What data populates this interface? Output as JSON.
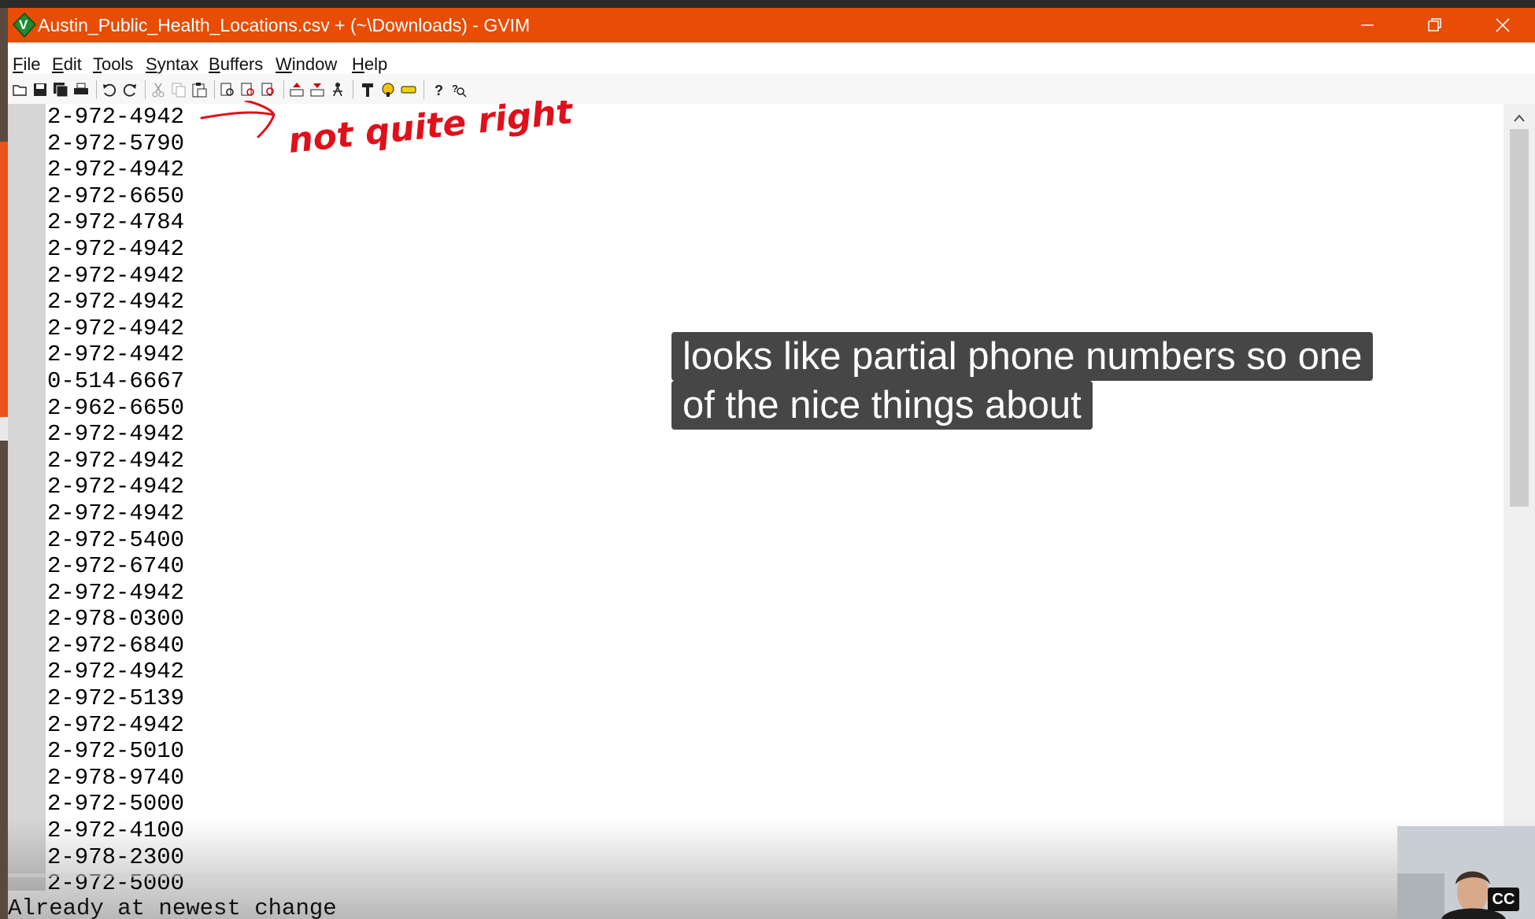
{
  "window": {
    "title": "Austin_Public_Health_Locations.csv + (~\\Downloads) - GVIM",
    "accent_color": "#e84c05"
  },
  "menu": {
    "items": [
      {
        "u": "F",
        "rest": "ile"
      },
      {
        "u": "E",
        "rest": "dit"
      },
      {
        "u": "T",
        "rest": "ools"
      },
      {
        "u": "S",
        "rest": "yntax"
      },
      {
        "u": "B",
        "rest": "uffers"
      },
      {
        "u": "W",
        "rest": "indow"
      },
      {
        "u": "H",
        "rest": "elp"
      }
    ]
  },
  "toolbar": {
    "icons": [
      "open-icon",
      "save-icon",
      "save-all-icon",
      "print-icon",
      "undo-icon",
      "redo-icon",
      "cut-icon",
      "copy-icon",
      "paste-icon",
      "replace-icon",
      "find-next-icon",
      "find-prev-icon",
      "load-session-icon",
      "save-session-icon",
      "run-script-icon",
      "make-icon",
      "run-ctags-icon",
      "tag-jump-icon",
      "help-icon",
      "find-help-icon"
    ]
  },
  "editor": {
    "lines": [
      "2-972-4942",
      "2-972-5790",
      "2-972-4942",
      "2-972-6650",
      "2-972-4784",
      "2-972-4942",
      "2-972-4942",
      "2-972-4942",
      "2-972-4942",
      "2-972-4942",
      "0-514-6667",
      "2-962-6650",
      "2-972-4942",
      "2-972-4942",
      "2-972-4942",
      "2-972-4942",
      "2-972-5400",
      "2-972-6740",
      "2-972-4942",
      "2-978-0300",
      "2-972-6840",
      "2-972-4942",
      "2-972-5139",
      "2-972-4942",
      "2-972-5010",
      "2-978-9740",
      "2-972-5000",
      "2-972-4100",
      "2-978-2300",
      "2-972-5000"
    ]
  },
  "status": {
    "message": "Already at newest change"
  },
  "annotation": {
    "text": "not quite right",
    "color": "#e0101a"
  },
  "caption": {
    "line1": "looks like partial phone numbers so one",
    "line2": "of the nice things about"
  },
  "player": {
    "cc_label": "CC"
  }
}
